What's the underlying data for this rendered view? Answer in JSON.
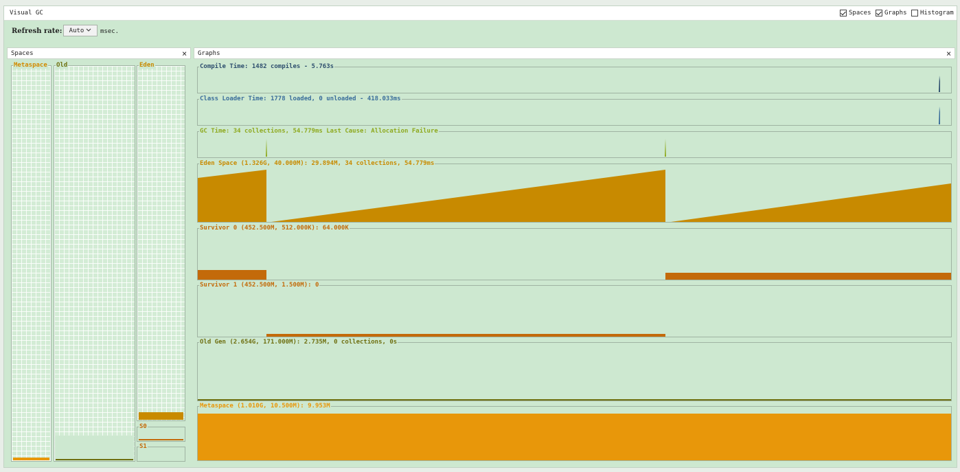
{
  "window": {
    "title": "Visual GC",
    "toggles": [
      {
        "label": "Spaces",
        "checked": true
      },
      {
        "label": "Graphs",
        "checked": true
      },
      {
        "label": "Histogram",
        "checked": false
      }
    ]
  },
  "refresh": {
    "label": "Refresh rate:",
    "value": "Auto",
    "unit": "msec."
  },
  "spaces_panel": {
    "title": "Spaces",
    "close": "×",
    "metaspace": {
      "label": "Metaspace",
      "fill_fraction": 0.008
    },
    "old": {
      "label": "Old",
      "fill_fraction": 0.003
    },
    "eden": {
      "label": "Eden",
      "fill_fraction": 0.022
    },
    "s0": {
      "label": "S0",
      "fill_fraction": 0.1
    },
    "s1": {
      "label": "S1",
      "fill_fraction": 0.0
    }
  },
  "graphs_panel": {
    "title": "Graphs",
    "close": "×",
    "graphs": [
      {
        "key": "compile",
        "label": "Compile Time: 1482 compiles - 5.763s",
        "color": "#2e4f6e"
      },
      {
        "key": "classloader",
        "label": "Class Loader Time: 1778 loaded, 0 unloaded - 418.033ms",
        "color": "#3a6d9a"
      },
      {
        "key": "gc",
        "label": "GC Time: 34 collections, 54.779ms Last Cause: Allocation Failure",
        "color": "#8ea91e"
      },
      {
        "key": "eden",
        "label": "Eden Space (1.326G, 40.000M): 29.894M, 34 collections, 54.779ms",
        "color": "#c88a00"
      },
      {
        "key": "s0",
        "label": "Survivor 0 (452.500M, 512.000K): 64.000K",
        "color": "#c36a0a"
      },
      {
        "key": "s1",
        "label": "Survivor 1 (452.500M, 1.500M): 0",
        "color": "#c36a0a"
      },
      {
        "key": "old",
        "label": "Old Gen (2.654G, 171.000M): 2.735M, 0 collections, 0s",
        "color": "#6e6f10"
      },
      {
        "key": "metaspace",
        "label": "Metaspace (1.010G, 10.500M): 9.953M",
        "color": "#e8970a"
      }
    ]
  },
  "colors": {
    "panel_bg": "#cde8d0",
    "metaspace_fill": "#e8970a",
    "old_fill": "#6e6f10",
    "eden_fill": "#c88a00",
    "survivor_fill": "#c36a0a"
  }
}
